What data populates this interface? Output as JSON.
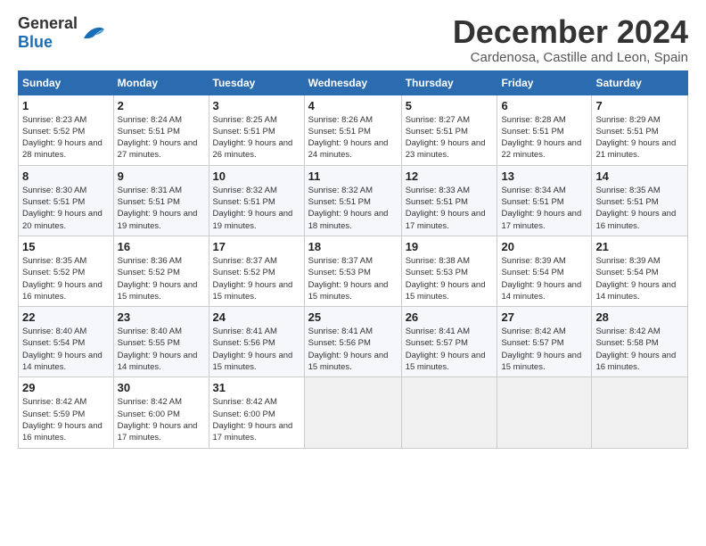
{
  "logo": {
    "general": "General",
    "blue": "Blue"
  },
  "title": "December 2024",
  "location": "Cardenosa, Castille and Leon, Spain",
  "weekdays": [
    "Sunday",
    "Monday",
    "Tuesday",
    "Wednesday",
    "Thursday",
    "Friday",
    "Saturday"
  ],
  "weeks": [
    [
      {
        "day": "1",
        "sunrise": "8:23 AM",
        "sunset": "5:52 PM",
        "daylight": "9 hours and 28 minutes."
      },
      {
        "day": "2",
        "sunrise": "8:24 AM",
        "sunset": "5:51 PM",
        "daylight": "9 hours and 27 minutes."
      },
      {
        "day": "3",
        "sunrise": "8:25 AM",
        "sunset": "5:51 PM",
        "daylight": "9 hours and 26 minutes."
      },
      {
        "day": "4",
        "sunrise": "8:26 AM",
        "sunset": "5:51 PM",
        "daylight": "9 hours and 24 minutes."
      },
      {
        "day": "5",
        "sunrise": "8:27 AM",
        "sunset": "5:51 PM",
        "daylight": "9 hours and 23 minutes."
      },
      {
        "day": "6",
        "sunrise": "8:28 AM",
        "sunset": "5:51 PM",
        "daylight": "9 hours and 22 minutes."
      },
      {
        "day": "7",
        "sunrise": "8:29 AM",
        "sunset": "5:51 PM",
        "daylight": "9 hours and 21 minutes."
      }
    ],
    [
      {
        "day": "8",
        "sunrise": "8:30 AM",
        "sunset": "5:51 PM",
        "daylight": "9 hours and 20 minutes."
      },
      {
        "day": "9",
        "sunrise": "8:31 AM",
        "sunset": "5:51 PM",
        "daylight": "9 hours and 19 minutes."
      },
      {
        "day": "10",
        "sunrise": "8:32 AM",
        "sunset": "5:51 PM",
        "daylight": "9 hours and 19 minutes."
      },
      {
        "day": "11",
        "sunrise": "8:32 AM",
        "sunset": "5:51 PM",
        "daylight": "9 hours and 18 minutes."
      },
      {
        "day": "12",
        "sunrise": "8:33 AM",
        "sunset": "5:51 PM",
        "daylight": "9 hours and 17 minutes."
      },
      {
        "day": "13",
        "sunrise": "8:34 AM",
        "sunset": "5:51 PM",
        "daylight": "9 hours and 17 minutes."
      },
      {
        "day": "14",
        "sunrise": "8:35 AM",
        "sunset": "5:51 PM",
        "daylight": "9 hours and 16 minutes."
      }
    ],
    [
      {
        "day": "15",
        "sunrise": "8:35 AM",
        "sunset": "5:52 PM",
        "daylight": "9 hours and 16 minutes."
      },
      {
        "day": "16",
        "sunrise": "8:36 AM",
        "sunset": "5:52 PM",
        "daylight": "9 hours and 15 minutes."
      },
      {
        "day": "17",
        "sunrise": "8:37 AM",
        "sunset": "5:52 PM",
        "daylight": "9 hours and 15 minutes."
      },
      {
        "day": "18",
        "sunrise": "8:37 AM",
        "sunset": "5:53 PM",
        "daylight": "9 hours and 15 minutes."
      },
      {
        "day": "19",
        "sunrise": "8:38 AM",
        "sunset": "5:53 PM",
        "daylight": "9 hours and 15 minutes."
      },
      {
        "day": "20",
        "sunrise": "8:39 AM",
        "sunset": "5:54 PM",
        "daylight": "9 hours and 14 minutes."
      },
      {
        "day": "21",
        "sunrise": "8:39 AM",
        "sunset": "5:54 PM",
        "daylight": "9 hours and 14 minutes."
      }
    ],
    [
      {
        "day": "22",
        "sunrise": "8:40 AM",
        "sunset": "5:54 PM",
        "daylight": "9 hours and 14 minutes."
      },
      {
        "day": "23",
        "sunrise": "8:40 AM",
        "sunset": "5:55 PM",
        "daylight": "9 hours and 14 minutes."
      },
      {
        "day": "24",
        "sunrise": "8:41 AM",
        "sunset": "5:56 PM",
        "daylight": "9 hours and 15 minutes."
      },
      {
        "day": "25",
        "sunrise": "8:41 AM",
        "sunset": "5:56 PM",
        "daylight": "9 hours and 15 minutes."
      },
      {
        "day": "26",
        "sunrise": "8:41 AM",
        "sunset": "5:57 PM",
        "daylight": "9 hours and 15 minutes."
      },
      {
        "day": "27",
        "sunrise": "8:42 AM",
        "sunset": "5:57 PM",
        "daylight": "9 hours and 15 minutes."
      },
      {
        "day": "28",
        "sunrise": "8:42 AM",
        "sunset": "5:58 PM",
        "daylight": "9 hours and 16 minutes."
      }
    ],
    [
      {
        "day": "29",
        "sunrise": "8:42 AM",
        "sunset": "5:59 PM",
        "daylight": "9 hours and 16 minutes."
      },
      {
        "day": "30",
        "sunrise": "8:42 AM",
        "sunset": "6:00 PM",
        "daylight": "9 hours and 17 minutes."
      },
      {
        "day": "31",
        "sunrise": "8:42 AM",
        "sunset": "6:00 PM",
        "daylight": "9 hours and 17 minutes."
      },
      null,
      null,
      null,
      null
    ]
  ]
}
